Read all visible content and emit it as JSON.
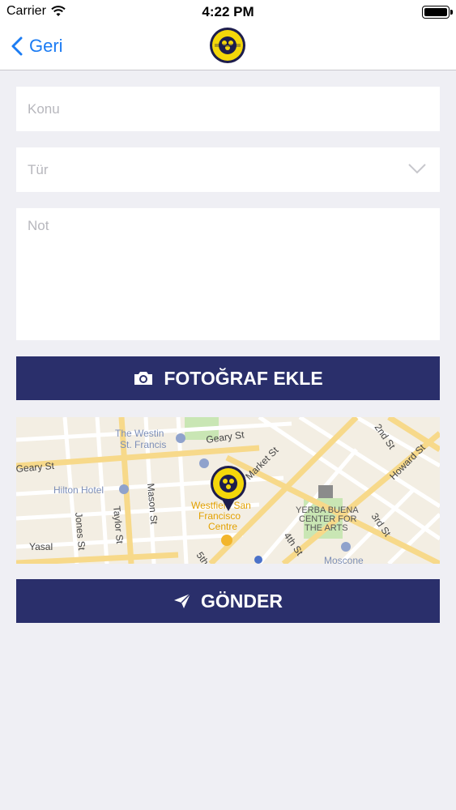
{
  "status_bar": {
    "carrier": "Carrier",
    "time": "4:22 PM"
  },
  "nav": {
    "back_label": "Geri",
    "logo_alt": "Buca Belediyesi logo"
  },
  "form": {
    "subject_placeholder": "Konu",
    "type_placeholder": "Tür",
    "note_placeholder": "Not"
  },
  "buttons": {
    "add_photo_label": "FOTOĞRAF EKLE",
    "send_label": "GÖNDER"
  },
  "map": {
    "labels": {
      "westin_1": "The Westin",
      "westin_2": "St. Francis",
      "geary_st_top": "Geary St",
      "geary_st_left": "Geary St",
      "hilton": "Hilton Hotel",
      "mason": "Mason St",
      "taylor": "Taylor St",
      "jones": "Jones St",
      "market": "Market St",
      "westfield_1": "Westfield San",
      "westfield_2": "Francisco",
      "westfield_3": "Centre",
      "yerba_1": "YERBA BUENA",
      "yerba_2": "CENTER FOR",
      "yerba_3": "THE ARTS",
      "second_st": "2nd St",
      "howard": "Howard St",
      "third_st": "3rd St",
      "fourth_st": "4th St",
      "fifth_st": "5th",
      "moscone": "Moscone",
      "legal": "Yasal"
    }
  },
  "colors": {
    "primary": "#2a2f6b",
    "link": "#1c7cf3",
    "background": "#efeff4",
    "logo_yellow": "#f4d70a"
  }
}
